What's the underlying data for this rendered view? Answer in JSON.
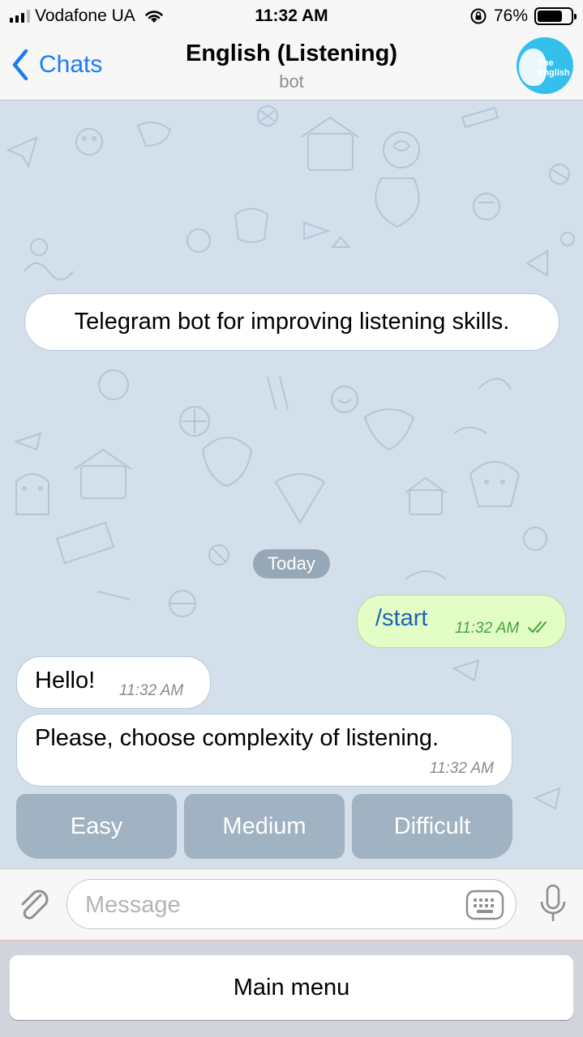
{
  "status_bar": {
    "carrier": "Vodafone UA",
    "time": "11:32 AM",
    "battery_percent": "76%",
    "battery_level": 0.76,
    "signal_icon": "cellular-signal-icon",
    "wifi_icon": "wifi-icon",
    "lock_icon": "orientation-lock-icon"
  },
  "nav": {
    "back_label": "Chats",
    "title": "English (Listening)",
    "subtitle": "bot",
    "avatar_text_1": "The",
    "avatar_text_2": "English",
    "avatar_color": "#35c0ec"
  },
  "chat": {
    "description": "Telegram bot for improving listening skills.",
    "date_label": "Today",
    "messages": [
      {
        "direction": "out",
        "text": "/start",
        "time": "11:32 AM",
        "status": "read"
      },
      {
        "direction": "in",
        "text": "Hello!",
        "time": "11:32 AM"
      },
      {
        "direction": "in",
        "text": "Please, choose complexity of listening.",
        "time": "11:32 AM"
      }
    ],
    "inline_buttons": [
      "Easy",
      "Medium",
      "Difficult"
    ]
  },
  "input": {
    "placeholder": "Message"
  },
  "reply_keyboard": {
    "main_menu_label": "Main menu"
  },
  "colors": {
    "accent": "#1c7cf2",
    "chat_background": "#d3dfea",
    "outgoing_bubble": "#e2fdc6",
    "read_check": "#46a33f"
  }
}
